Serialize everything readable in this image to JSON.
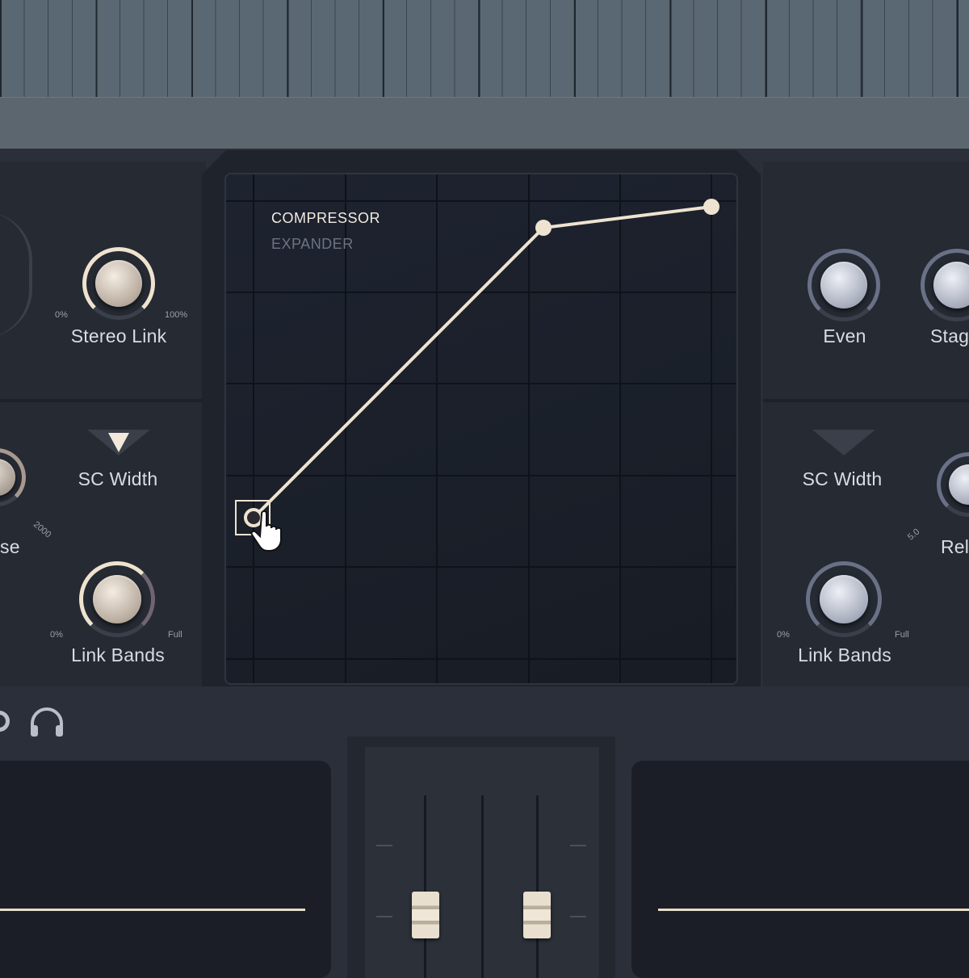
{
  "graph": {
    "modes": [
      "COMPRESSOR",
      "EXPANDER"
    ],
    "active_mode": "COMPRESSOR"
  },
  "left_panel": {
    "stereo_link": {
      "label": "Stereo Link",
      "min": "0%",
      "max": "100%"
    },
    "sc_width": {
      "label": "SC Width"
    },
    "release": {
      "label_partial": "se",
      "max": "2000"
    },
    "link_bands": {
      "label": "Link Bands",
      "min": "0%",
      "max": "Full"
    }
  },
  "right_panel": {
    "even": {
      "label": "Even"
    },
    "stage": {
      "label_partial": "Stag"
    },
    "sc_width": {
      "label": "SC Width"
    },
    "release": {
      "label_partial": "Rel",
      "min": "5.0"
    },
    "link_bands": {
      "label": "Link Bands",
      "min": "0%",
      "max": "Full"
    }
  },
  "colors": {
    "accent": "#eee3d0",
    "graph_bg": "#1b1f29",
    "panel": "#2a2f39"
  },
  "icons": [
    "headphones-icon",
    "pointer-hand-icon",
    "triangle-down-icon"
  ]
}
